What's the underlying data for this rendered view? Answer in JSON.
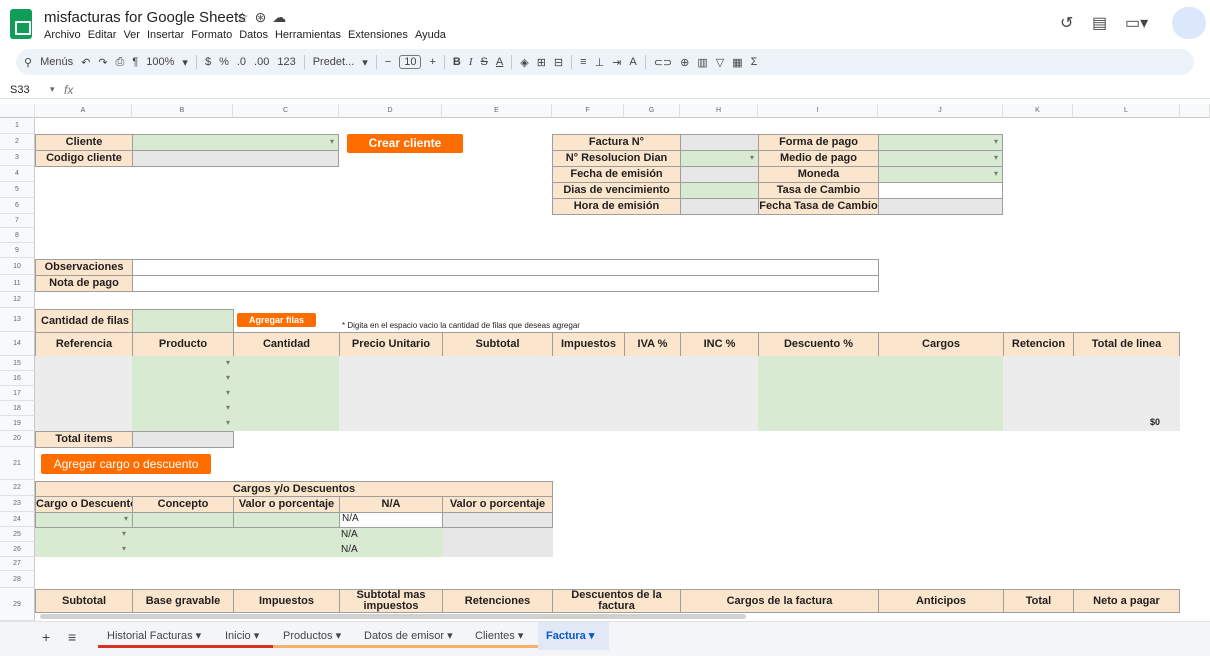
{
  "title": "misfacturas for Google Sheets",
  "menu": [
    "Archivo",
    "Editar",
    "Ver",
    "Insertar",
    "Formato",
    "Datos",
    "Herramientas",
    "Extensiones",
    "Ayuda"
  ],
  "toolbar": {
    "menus": "Menús",
    "zoom": "100%",
    "currency": "$",
    "percent": "%",
    "dec_less": ".0",
    "dec_more": ".00",
    "num": "123",
    "font": "Predet...",
    "font_size": "10"
  },
  "namebox": "S33",
  "fx": "fx",
  "columns": [
    "A",
    "B",
    "C",
    "D",
    "E",
    "F",
    "G",
    "H",
    "I",
    "J",
    "K",
    "L"
  ],
  "rows": [
    "1",
    "2",
    "3",
    "4",
    "5",
    "6",
    "7",
    "8",
    "9",
    "10",
    "11",
    "12",
    "13",
    "14",
    "15",
    "16",
    "17",
    "18",
    "19",
    "20",
    "21",
    "22",
    "23",
    "24",
    "25",
    "26",
    "27",
    "28",
    "29"
  ],
  "form": {
    "cliente": "Cliente",
    "codigo_cliente": "Codigo cliente",
    "crear_cliente": "Crear cliente",
    "factura_n": "Factura N°",
    "resolucion": "N° Resolucion Dian",
    "fecha_emision": "Fecha de emisión",
    "dias_venc": "Dias de vencimiento",
    "hora_emision": "Hora de emisión",
    "forma_pago": "Forma de pago",
    "medio_pago": "Medio de pago",
    "moneda": "Moneda",
    "tasa_cambio": "Tasa de Cambio",
    "fecha_tasa": "Fecha Tasa de Cambio",
    "observaciones": "Observaciones",
    "nota_pago": "Nota de pago",
    "cantidad_filas": "Cantidad de filas",
    "agregar_filas": "Agregar filas",
    "nota_filas": "* Digita en el espacio vacio la cantidad de filas que deseas agregar",
    "total_items": "Total items",
    "agregar_cargo": "Agregar cargo o descuento",
    "total_linea_val": "$0"
  },
  "items_headers": [
    "Referencia",
    "Producto",
    "Cantidad",
    "Precio Unitario",
    "Subtotal",
    "Impuestos",
    "IVA %",
    "INC %",
    "Descuento %",
    "Cargos",
    "Retencion",
    "Total de linea"
  ],
  "cargos": {
    "title": "Cargos y/o Descuentos",
    "headers": [
      "Cargo o Descuento",
      "Concepto",
      "Valor o porcentaje",
      "N/A",
      "Valor o porcentaje"
    ],
    "na": [
      "N/A",
      "N/A",
      "N/A"
    ]
  },
  "totals_headers": [
    "Subtotal",
    "Base gravable",
    "Impuestos",
    "Subtotal mas impuestos",
    "Retenciones",
    "Descuentos de la factura",
    "Cargos de la factura",
    "Anticipos",
    "Total",
    "Neto a pagar"
  ],
  "tabs": [
    "Historial Facturas",
    "Inicio",
    "Productos",
    "Datos de emisor",
    "Clientes",
    "Factura"
  ]
}
